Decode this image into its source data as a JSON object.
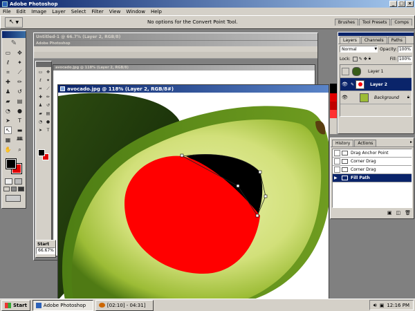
{
  "app": {
    "title": "Adobe Photoshop",
    "menu": [
      "File",
      "Edit",
      "Image",
      "Layer",
      "Select",
      "Filter",
      "View",
      "Window",
      "Help"
    ],
    "options_bar_text": "No options for the Convert Point Tool.",
    "dock_tabs": [
      "Brushes",
      "Tool Presets",
      "Comps"
    ]
  },
  "windows": {
    "back1_title": "Untitled-1 @ 66.7% (Layer 2, RGB/8)",
    "back2_title": "Adobe Photoshop",
    "back3_title": "avocado.jpg @ 118% (Layer 2, RGB/8)",
    "front_title": "avocado.jpg @ 118% (Layer 2, RGB/8#)",
    "start_label": "Start",
    "zoom_label": "66.67%"
  },
  "layers_panel": {
    "tabs": [
      "Layers",
      "Channels",
      "Paths"
    ],
    "blend_mode": "Normal",
    "opacity_label": "Opacity:",
    "opacity_value": "100%",
    "lock_label": "Lock:",
    "fill_label": "Fill:",
    "fill_value": "100%",
    "layers": [
      {
        "name": "Layer 1",
        "selected": false,
        "visible": false
      },
      {
        "name": "Layer 2",
        "selected": true,
        "visible": true
      },
      {
        "name": "Background",
        "selected": false,
        "visible": true
      }
    ]
  },
  "history_panel": {
    "tabs": [
      "History",
      "Actions"
    ],
    "items": [
      {
        "name": "Drag Anchor Point",
        "selected": false
      },
      {
        "name": "Corner Drag",
        "selected": false
      },
      {
        "name": "Corner Drag",
        "selected": false
      },
      {
        "name": "Fill Path",
        "selected": true
      }
    ]
  },
  "taskbar": {
    "start": "Start",
    "photoshop": "Adobe Photoshop",
    "recorder": "[02:10] - 04:31]",
    "clock": "12:16 PM"
  },
  "colors": {
    "foreground": "#000000",
    "background": "#e00000",
    "red_fill": "#ff0000",
    "titlebar": "#0a246a"
  }
}
